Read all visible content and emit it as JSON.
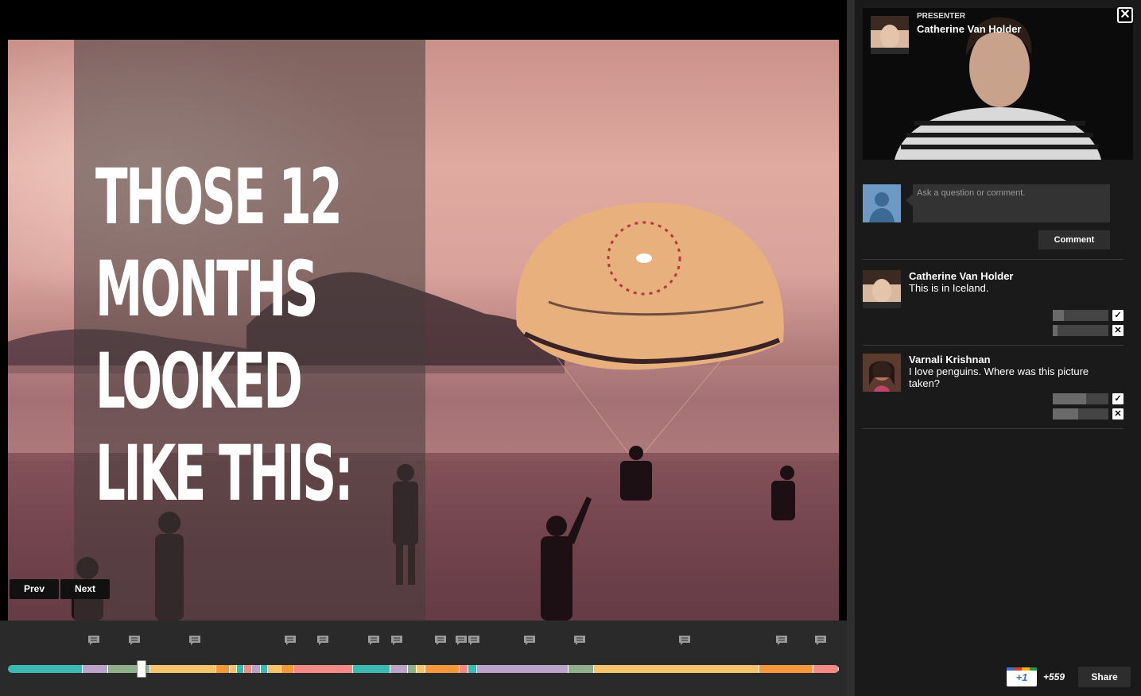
{
  "slide": {
    "headline_lines": [
      "THOSE 12",
      "MONTHS",
      "LOOKED",
      "LIKE THIS:"
    ],
    "prev_label": "Prev",
    "next_label": "Next"
  },
  "timeline": {
    "marker_icon": "speech-bubble-icon",
    "segments": [
      {
        "color": "#3cb9b0",
        "weight": 9
      },
      {
        "color": "#b9a3c9",
        "weight": 3
      },
      {
        "color": "#8fb08a",
        "weight": 5
      },
      {
        "color": "#f7c36b",
        "weight": 8
      },
      {
        "color": "#f5973a",
        "weight": 1.5
      },
      {
        "color": "#f7c36b",
        "weight": 0.8
      },
      {
        "color": "#3cb9b0",
        "weight": 0.8
      },
      {
        "color": "#f48a86",
        "weight": 0.8
      },
      {
        "color": "#b9a3c9",
        "weight": 1
      },
      {
        "color": "#3cb9b0",
        "weight": 0.8
      },
      {
        "color": "#f7c36b",
        "weight": 1.5
      },
      {
        "color": "#f5973a",
        "weight": 1.5
      },
      {
        "color": "#f48a86",
        "weight": 7
      },
      {
        "color": "#3cb9b0",
        "weight": 4.5
      },
      {
        "color": "#b9a3c9",
        "weight": 2
      },
      {
        "color": "#8fb08a",
        "weight": 1
      },
      {
        "color": "#f7c36b",
        "weight": 1
      },
      {
        "color": "#f5973a",
        "weight": 4
      },
      {
        "color": "#f48a86",
        "weight": 1
      },
      {
        "color": "#3cb9b0",
        "weight": 1
      },
      {
        "color": "#b9a3c9",
        "weight": 11
      },
      {
        "color": "#8fb08a",
        "weight": 3
      },
      {
        "color": "#f7c36b",
        "weight": 20
      },
      {
        "color": "#f5973a",
        "weight": 6.5
      },
      {
        "color": "#f48a86",
        "weight": 3
      }
    ]
  },
  "presenter": {
    "role": "PRESENTER",
    "name": "Catherine Van Holder"
  },
  "composer": {
    "placeholder": "Ask a question or comment.",
    "submit_label": "Comment"
  },
  "comments": [
    {
      "author": "Catherine Van Holder",
      "text": "This is in Iceland.",
      "up_fraction": 0.2,
      "down_fraction": 0.08
    },
    {
      "author": "Varnali Krishnan",
      "text": "I love penguins. Where was this picture taken?",
      "up_fraction": 0.6,
      "down_fraction": 0.45
    }
  ],
  "social": {
    "plusone_label": "+1",
    "plusone_count": "+559",
    "share_label": "Share"
  },
  "colors": {
    "google_blue": "#3b74c7",
    "google_red": "#d6412f",
    "google_yellow": "#f4b400",
    "google_green": "#0f9d58"
  }
}
